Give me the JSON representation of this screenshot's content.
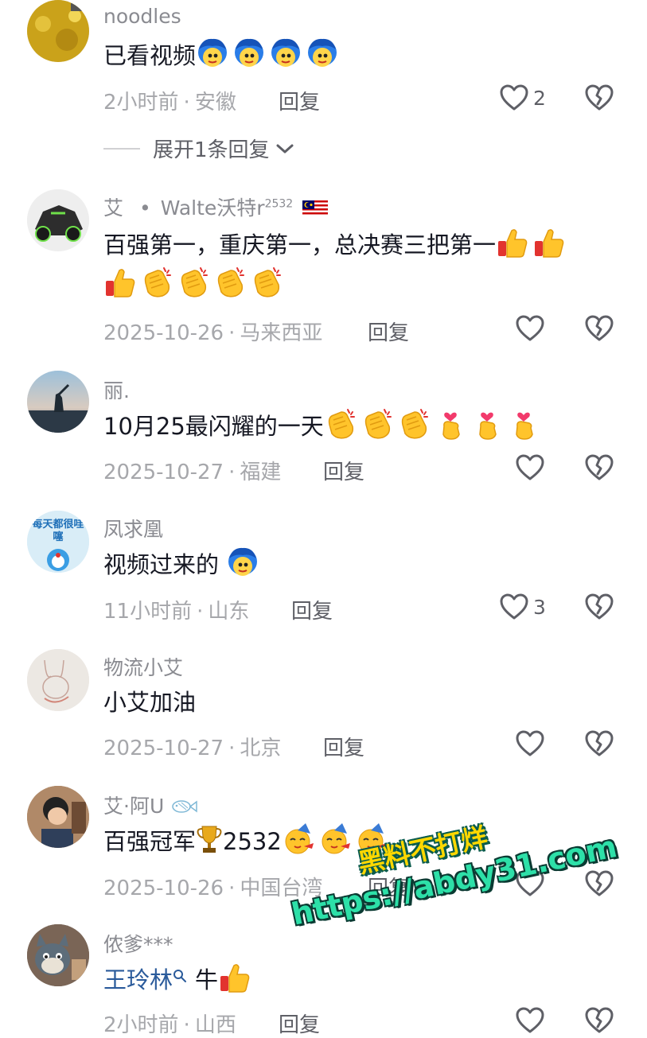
{
  "comments": [
    {
      "username": "noodles",
      "text": "已看视频",
      "emojis": [
        "blue-hair-face",
        "blue-hair-face",
        "blue-hair-face",
        "blue-hair-face"
      ],
      "time": "2小时前",
      "location": "安徽",
      "reply_label": "回复",
      "like_count": "2",
      "expand_label": "展开1条回复"
    },
    {
      "username_main": "艾",
      "username_sep": "•",
      "username_rest": "Walte沃特r",
      "username_sup": "2532",
      "text_line1": "百强第一，重庆第一，总决赛三把第一",
      "emojis_line1": [
        "thumbs-up",
        "thumbs-up"
      ],
      "emojis_line2": [
        "thumbs-up",
        "clapping-hands",
        "clapping-hands",
        "clapping-hands",
        "clapping-hands"
      ],
      "time": "2025-10-26",
      "location": "马来西亚",
      "reply_label": "回复"
    },
    {
      "username": "丽.",
      "text": "10月25最闪耀的一天",
      "emojis": [
        "clapping-hands",
        "clapping-hands",
        "clapping-hands",
        "finger-heart",
        "finger-heart",
        "finger-heart"
      ],
      "time": "2025-10-27",
      "location": "福建",
      "reply_label": "回复"
    },
    {
      "username": "凤求凰",
      "avatar_text": "每天都很哇噻",
      "text": "视频过来的",
      "emojis": [
        "blue-hair-face"
      ],
      "time": "11小时前",
      "location": "山东",
      "reply_label": "回复",
      "like_count": "3"
    },
    {
      "username": "物流小艾",
      "text": "小艾加油",
      "time": "2025-10-27",
      "location": "北京",
      "reply_label": "回复"
    },
    {
      "username": "艾·阿U",
      "username_icon": "fish-icon",
      "text": "百强冠军",
      "text_trophy": "trophy",
      "text_after": "2532",
      "emojis": [
        "party-face",
        "party-face",
        "party-face"
      ],
      "time": "2025-10-26",
      "location": "中国台湾",
      "reply_label": "回复"
    },
    {
      "username": "侬爹***",
      "mention": "王玲林",
      "text": "牛",
      "emojis": [
        "thumbs-up"
      ],
      "time": "2小时前",
      "location": "山西",
      "reply_label": "回复"
    }
  ],
  "separator": "·",
  "watermark": {
    "line1": "黑料不打烊",
    "line2": "https://abdy31.com"
  },
  "colors": {
    "username": "#8a8b91",
    "meta": "#a6a7ab",
    "mention": "#2b5b9b",
    "watermark_yellow": "#ffd800",
    "watermark_green": "#2de0a8"
  }
}
